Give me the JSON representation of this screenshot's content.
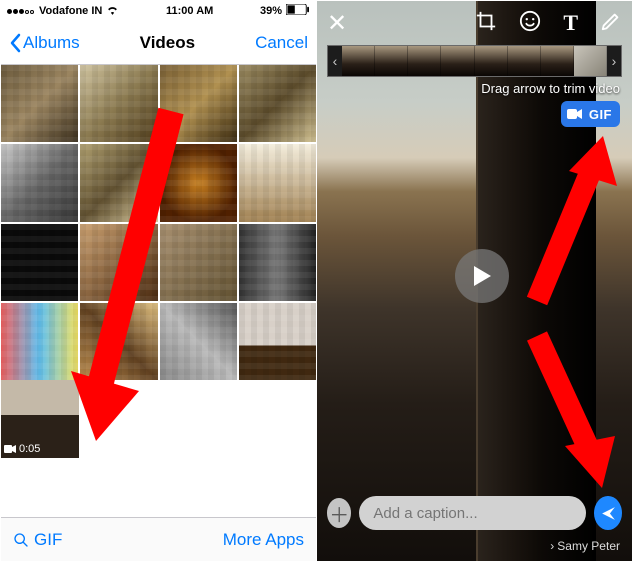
{
  "left": {
    "status": {
      "carrier": "Vodafone IN",
      "time": "11:00 AM",
      "battery": "39%"
    },
    "nav": {
      "back": "Albums",
      "title": "Videos",
      "cancel": "Cancel"
    },
    "video_thumb": {
      "duration": "0:05"
    },
    "footer": {
      "gif": "GIF",
      "more": "More Apps"
    }
  },
  "right": {
    "trim_hint": "Drag arrow to trim video",
    "gif_toggle": "GIF",
    "caption_placeholder": "Add a caption...",
    "recipient": "Samy Peter"
  }
}
